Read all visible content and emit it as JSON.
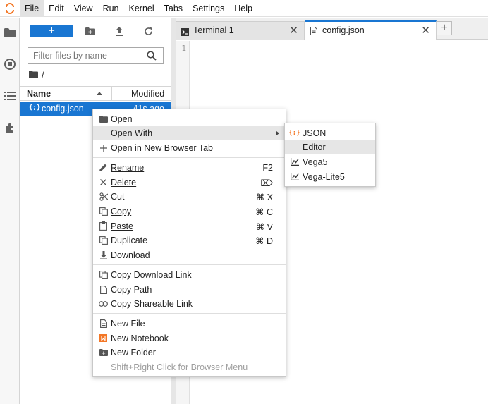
{
  "menubar": {
    "items": [
      "File",
      "Edit",
      "View",
      "Run",
      "Kernel",
      "Tabs",
      "Settings",
      "Help"
    ],
    "active": "File"
  },
  "filebrowser": {
    "new_label": "+",
    "filter_placeholder": "Filter files by name",
    "breadcrumb": "/",
    "columns": {
      "name": "Name",
      "modified": "Modified"
    },
    "files": [
      {
        "icon": "{;}",
        "name": "config.json",
        "modified": "41s ago"
      }
    ]
  },
  "tabs": [
    {
      "label": "Terminal 1",
      "icon": "terminal-icon",
      "close": "✕"
    },
    {
      "label": "config.json",
      "icon": "file-icon",
      "close": "✕"
    }
  ],
  "add_tab_label": "+",
  "editor": {
    "line_numbers": [
      "1"
    ]
  },
  "context_menu": {
    "open": "Open",
    "open_with": "Open With",
    "open_new_tab": "Open in New Browser Tab",
    "rename": "Rename",
    "rename_shortcut": "F2",
    "delete": "Delete",
    "delete_shortcut": "⌦",
    "cut": "Cut",
    "cut_shortcut": "⌘ X",
    "copy": "Copy",
    "copy_shortcut": "⌘ C",
    "paste": "Paste",
    "paste_shortcut": "⌘ V",
    "duplicate": "Duplicate",
    "duplicate_shortcut": "⌘ D",
    "download": "Download",
    "copy_download_link": "Copy Download Link",
    "copy_path": "Copy Path",
    "copy_shareable_link": "Copy Shareable Link",
    "new_file": "New File",
    "new_notebook": "New Notebook",
    "new_folder": "New Folder",
    "browser_menu_hint": "Shift+Right Click for Browser Menu"
  },
  "open_with_submenu": {
    "json": "JSON",
    "json_icon": "{;}",
    "editor": "Editor",
    "vega5": "Vega5",
    "vega_lite5": "Vega-Lite5"
  },
  "colors": {
    "accent": "#1976d2",
    "logo": "#f37726",
    "json_icon": "#f37726",
    "notebook_icon": "#f37726"
  }
}
